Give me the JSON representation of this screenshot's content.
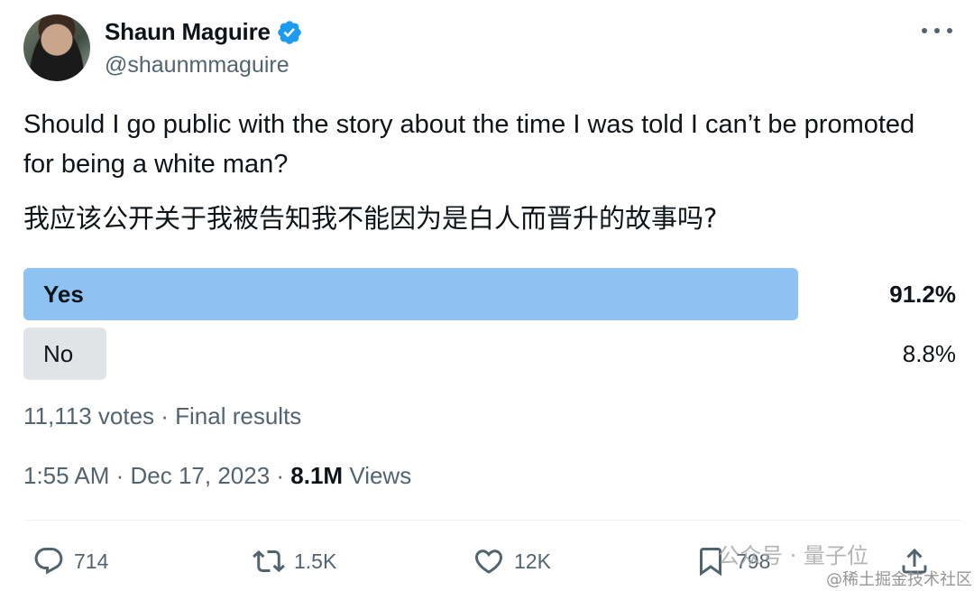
{
  "author": {
    "display_name": "Shaun Maguire",
    "handle": "@shaunmmaguire",
    "verified": true
  },
  "icons": {
    "verified": "verified-badge-icon",
    "more": "more-horizontal-icon",
    "reply": "reply-icon",
    "retweet": "retweet-icon",
    "like": "heart-icon",
    "bookmark": "bookmark-icon",
    "share": "share-icon"
  },
  "colors": {
    "accent": "#1d9bf0",
    "poll_winner": "#8ec2f2",
    "poll_other": "#e1e4e6",
    "muted_text": "#536471"
  },
  "tweet": {
    "text_en": "Should I go public with the story about the time I was told I can’t be promoted for being a white man?",
    "text_zh": "我应该公开关于我被告知我不能因为是白人而晋升的故事吗?"
  },
  "poll": {
    "options": [
      {
        "label": "Yes",
        "percent_text": "91.2%",
        "fraction": 0.912,
        "winner": true
      },
      {
        "label": "No",
        "percent_text": "8.8%",
        "fraction": 0.088,
        "winner": false
      }
    ],
    "meta": "11,113 votes · Final results"
  },
  "timestamp": {
    "time": "1:55 AM · Dec 17, 2023 · ",
    "views_count": "8.1M",
    "views_label": " Views"
  },
  "actions": {
    "reply_count": "714",
    "retweet_count": "1.5K",
    "like_count": "12K",
    "bookmark_count": "798"
  },
  "watermark": {
    "line1": "公众号 · 量子位",
    "line2": "@稀土掘金技术社区"
  }
}
